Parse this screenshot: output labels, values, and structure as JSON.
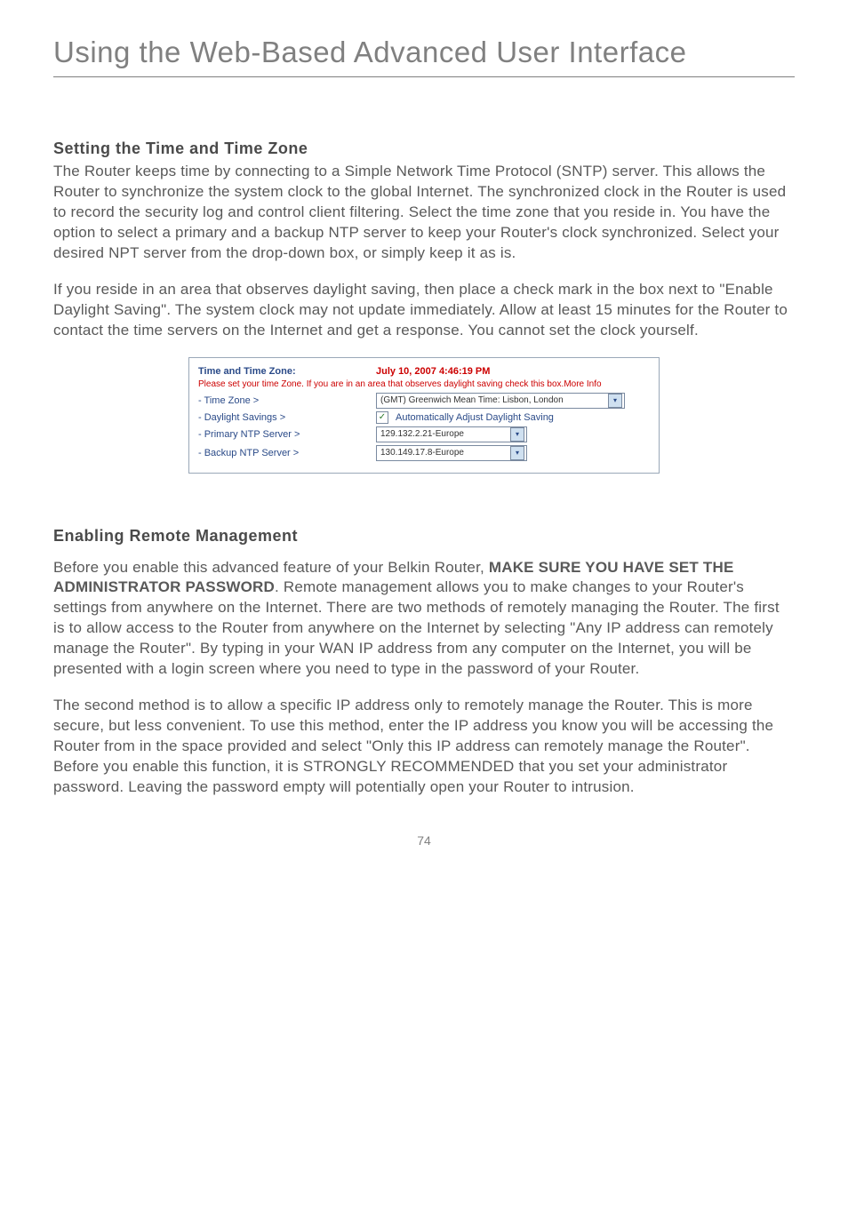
{
  "title": "Using the Web-Based Advanced User Interface",
  "section1": {
    "heading": "Setting the Time and Time Zone",
    "p1": "The Router keeps time by connecting to a Simple Network Time Protocol (SNTP) server. This allows the Router to synchronize the system clock to the global Internet. The synchronized clock in the Router is used to record the security log and control client filtering. Select the time zone that you reside in. You have the option to select a primary and a backup NTP server to keep your Router's clock synchronized. Select your desired NPT server from the drop-down box, or simply keep it as is.",
    "p2": "If you reside in an area that observes daylight saving, then place a check mark in the box next to \"Enable Daylight Saving\". The system clock may not update immediately. Allow at least 15 minutes for the Router to contact the time servers on the Internet and get a response. You cannot set the clock yourself."
  },
  "panel": {
    "heading": "Time and Time Zone:",
    "datetime": "July 10, 2007   4:46:19 PM",
    "note": "Please set your time Zone. If you are in an area that observes daylight saving check this box.More Info",
    "tz_label": "- Time Zone >",
    "tz_value": "(GMT) Greenwich Mean Time: Lisbon, London",
    "dst_label": "- Daylight Savings >",
    "dst_cb": "Automatically Adjust Daylight Saving",
    "primary_label": "- Primary NTP Server >",
    "primary_value": "129.132.2.21-Europe",
    "backup_label": "- Backup NTP Server >",
    "backup_value": "130.149.17.8-Europe"
  },
  "section2": {
    "heading": "Enabling Remote Management",
    "p1a": "Before you enable this advanced feature of your Belkin Router, ",
    "p1b": "MAKE SURE YOU HAVE SET THE ADMINISTRATOR PASSWORD",
    "p1c": ". Remote management allows you to make changes to your Router's settings from anywhere on the Internet. There are two methods of remotely managing the Router. The first is to allow access to the Router from anywhere on the Internet by selecting \"Any IP address can remotely manage the Router\". By typing in your WAN IP address from any computer on the Internet, you will be presented with a login screen where you need to type in the password of your Router.",
    "p2": "The second method is to allow a specific IP address only to remotely manage the Router. This is more secure, but less convenient. To use this method, enter the IP address you know you will be accessing the Router from in the space provided and select \"Only this IP address can remotely manage the Router\". Before you enable this function, it is STRONGLY RECOMMENDED that you set your administrator password. Leaving the password empty will potentially open your Router to intrusion."
  },
  "page_number": "74",
  "glyphs": {
    "down": "▾",
    "check": "✓"
  }
}
